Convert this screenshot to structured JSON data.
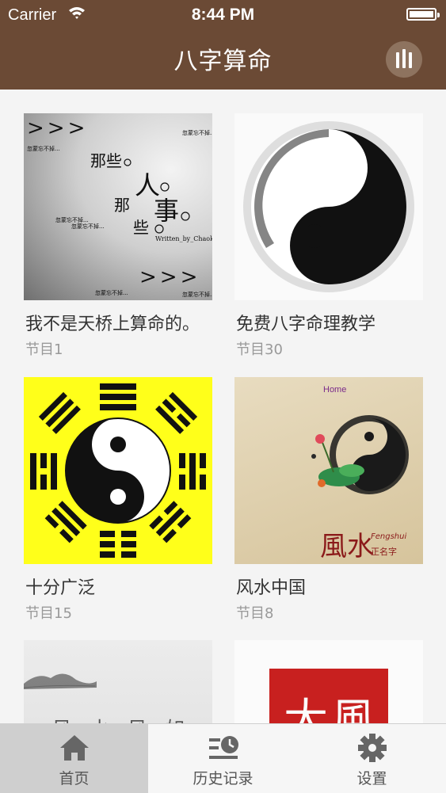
{
  "status_bar": {
    "carrier": "Carrier",
    "time": "8:44 PM"
  },
  "nav": {
    "title": "八字算命",
    "now_playing_icon": "equalizer-bars-icon"
  },
  "albums": [
    {
      "title": "我不是天桥上算命的。",
      "count": "节目1",
      "art": {
        "top_left": ">>>",
        "bottom_right": ">>>",
        "line1": "那些",
        "line2": "人",
        "line3": "那",
        "line4": "事",
        "line5": "些",
        "credit": "Written_by_Chaoktree",
        "small": "忽蒙忘不掉..."
      }
    },
    {
      "title": "免费八字命理教学",
      "count": "节目30"
    },
    {
      "title": "十分广泛",
      "count": "节目15"
    },
    {
      "title": "风水中国",
      "count": "节目8",
      "art": {
        "brand": "Home",
        "callig": "風水",
        "sub": "Fengshui",
        "stamp": "正名字"
      }
    },
    {
      "art": {
        "text": "风 水 风 如 专"
      }
    },
    {
      "art": {
        "seal": "大風"
      }
    }
  ],
  "tabs": [
    {
      "label": "首页",
      "icon": "home-icon",
      "active": true
    },
    {
      "label": "历史记录",
      "icon": "history-icon",
      "active": false
    },
    {
      "label": "设置",
      "icon": "gear-icon",
      "active": false
    }
  ],
  "colors": {
    "nav_bg": "#6b4a35",
    "tab_active_bg": "#cfcfcf",
    "page_bg": "#f4f4f4"
  }
}
